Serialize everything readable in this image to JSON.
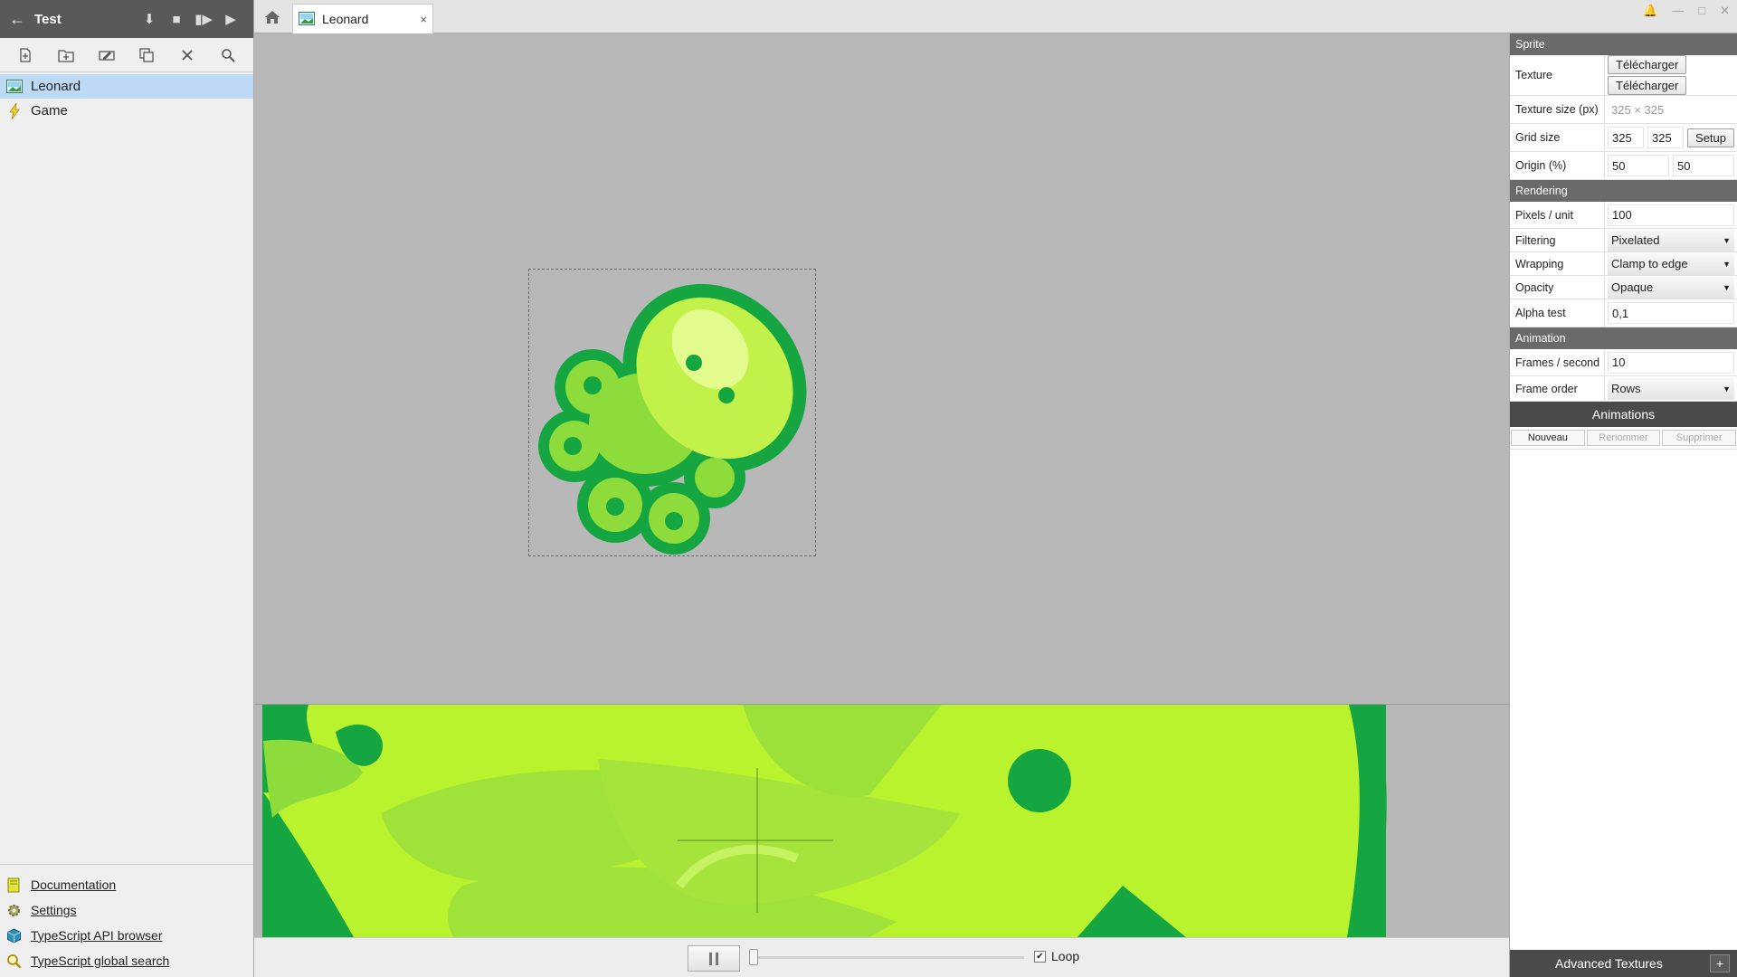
{
  "project": {
    "title": "Test",
    "back_icon": "arrow-left-icon"
  },
  "toolbar_icons": [
    "new-asset-icon",
    "new-folder-icon",
    "rename-icon",
    "duplicate-icon",
    "delete-icon",
    "search-icon"
  ],
  "tree": {
    "items": [
      {
        "label": "Leonard",
        "icon": "sprite-icon",
        "selected": true
      },
      {
        "label": "Game",
        "icon": "lightning-icon",
        "selected": false
      }
    ]
  },
  "links": {
    "items": [
      {
        "label": "Documentation",
        "icon": "book-icon"
      },
      {
        "label": "Settings",
        "icon": "gear-icon"
      },
      {
        "label": "TypeScript API browser",
        "icon": "cube-icon"
      },
      {
        "label": "TypeScript global search",
        "icon": "magnifier-icon"
      }
    ]
  },
  "tab": {
    "label": "Leonard",
    "close": "×"
  },
  "playbar": {
    "loop_label": "Loop",
    "loop_checked": true
  },
  "sprite": {
    "section": "Sprite",
    "texture_label": "Texture",
    "upload_button": "Télécharger",
    "download_button": "Télécharger",
    "texture_size_label": "Texture size (px)",
    "texture_size_value": "325 × 325",
    "grid_size_label": "Grid size",
    "grid_w": "325",
    "grid_h": "325",
    "setup_button": "Setup",
    "origin_label": "Origin (%)",
    "origin_x": "50",
    "origin_y": "50"
  },
  "rendering": {
    "section": "Rendering",
    "pixels_label": "Pixels / unit",
    "pixels_value": "100",
    "filtering_label": "Filtering",
    "filtering_value": "Pixelated",
    "wrapping_label": "Wrapping",
    "wrapping_value": "Clamp to edge",
    "opacity_label": "Opacity",
    "opacity_value": "Opaque",
    "alpha_label": "Alpha test",
    "alpha_value": "0,1"
  },
  "animation": {
    "section": "Animation",
    "fps_label": "Frames / second",
    "fps_value": "10",
    "frame_order_label": "Frame order",
    "frame_order_value": "Rows"
  },
  "animations": {
    "title": "Animations",
    "new_button": "Nouveau",
    "rename_button": "Renommer",
    "delete_button": "Supprimer"
  },
  "advanced": {
    "title": "Advanced Textures",
    "plus": "+"
  },
  "colors": {
    "dark_green": "#12a23f",
    "lime": "#b8f52f",
    "selection": "#bcdaf3"
  }
}
